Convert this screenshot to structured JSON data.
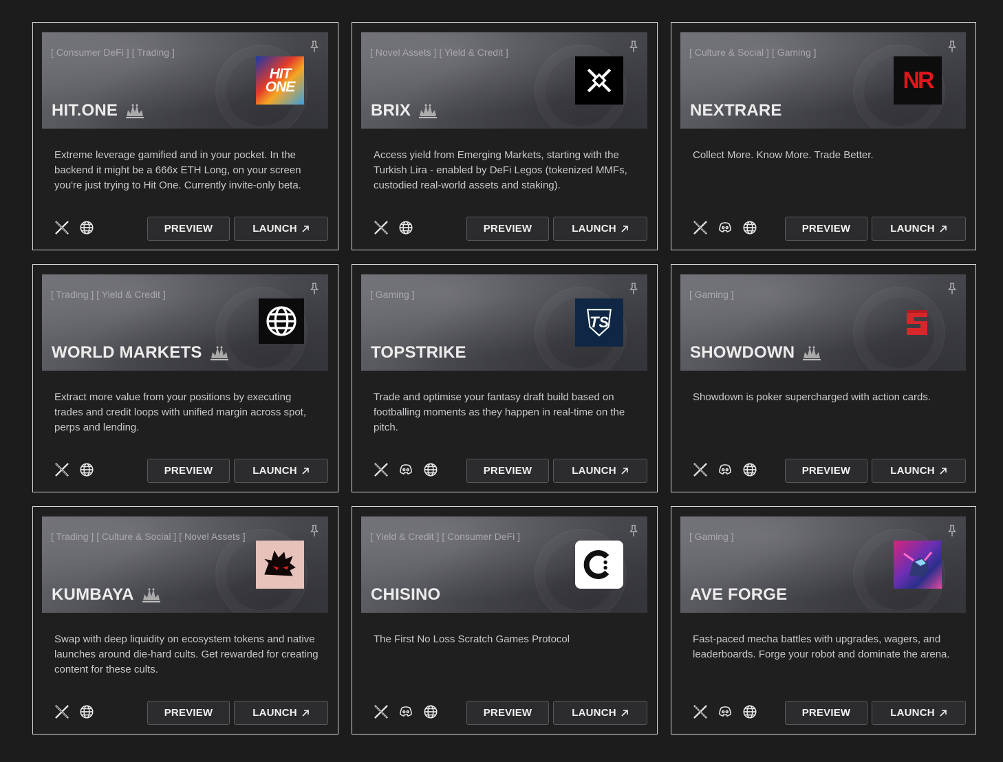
{
  "cards": [
    {
      "tags": [
        "[ Consumer DeFi ]",
        "[ Trading ]"
      ],
      "title": "HIT.ONE",
      "crown": true,
      "logo": "hitone",
      "description": "Extreme leverage gamified and in your pocket. In the backend it might be a 666x ETH Long, on your screen you're just trying to Hit One. Currently invite-only beta.",
      "socials": [
        "x",
        "globe"
      ],
      "preview": "PREVIEW",
      "launch": "LAUNCH"
    },
    {
      "tags": [
        "[ Novel Assets ]",
        "[ Yield & Credit ]"
      ],
      "title": "BRIX",
      "crown": true,
      "logo": "brix",
      "description": "Access yield from Emerging Markets, starting with the Turkish Lira - enabled by DeFi Legos (tokenized MMFs, custodied real-world assets and staking).",
      "socials": [
        "x",
        "globe"
      ],
      "preview": "PREVIEW",
      "launch": "LAUNCH"
    },
    {
      "tags": [
        "[ Culture & Social ]",
        "[ Gaming ]"
      ],
      "title": "NEXTRARE",
      "crown": false,
      "logo": "nextrare",
      "description": "Collect More. Know More. Trade Better.",
      "socials": [
        "x",
        "discord",
        "globe"
      ],
      "preview": "PREVIEW",
      "launch": "LAUNCH"
    },
    {
      "tags": [
        "[ Trading ]",
        "[ Yield & Credit ]"
      ],
      "title": "WORLD MARKETS",
      "crown": true,
      "logo": "world",
      "description": "Extract more value from your positions by executing trades and credit loops with unified margin across spot, perps and lending.",
      "socials": [
        "x",
        "globe"
      ],
      "preview": "PREVIEW",
      "launch": "LAUNCH"
    },
    {
      "tags": [
        "[ Gaming ]"
      ],
      "title": "TOPSTRIKE",
      "crown": false,
      "logo": "topstrike",
      "description": "Trade and optimise your fantasy draft build based on footballing moments as they happen in real-time on the pitch.",
      "socials": [
        "x",
        "discord",
        "globe"
      ],
      "preview": "PREVIEW",
      "launch": "LAUNCH"
    },
    {
      "tags": [
        "[ Gaming ]"
      ],
      "title": "SHOWDOWN",
      "crown": true,
      "logo": "showdown",
      "description": "Showdown is poker supercharged with action cards.",
      "socials": [
        "x",
        "discord",
        "globe"
      ],
      "preview": "PREVIEW",
      "launch": "LAUNCH"
    },
    {
      "tags": [
        "[ Trading ]",
        "[ Culture & Social ]",
        "[ Novel Assets ]"
      ],
      "title": "KUMBAYA",
      "crown": true,
      "logo": "kumbaya",
      "description": "Swap with deep liquidity on ecosystem tokens and native launches around die-hard cults. Get rewarded for creating content for these cults.",
      "socials": [
        "x",
        "globe"
      ],
      "preview": "PREVIEW",
      "launch": "LAUNCH"
    },
    {
      "tags": [
        "[ Yield & Credit ]",
        "[ Consumer DeFi ]"
      ],
      "title": "CHISINO",
      "crown": false,
      "logo": "chisino",
      "description": "The First No Loss Scratch Games Protocol",
      "socials": [
        "x",
        "discord",
        "globe"
      ],
      "preview": "PREVIEW",
      "launch": "LAUNCH"
    },
    {
      "tags": [
        "[ Gaming ]"
      ],
      "title": "AVE FORGE",
      "crown": false,
      "logo": "aveforge",
      "description": "Fast-paced mecha battles with upgrades, wagers, and leaderboards. Forge your robot and dominate the arena.",
      "socials": [
        "x",
        "discord",
        "globe"
      ],
      "preview": "PREVIEW",
      "launch": "LAUNCH"
    }
  ],
  "logo_text": {
    "hitone": "HIT ONE",
    "nextrare": "NR",
    "topstrike": "TS"
  },
  "colors": {
    "background": "#1c1c1d",
    "card_border": "#d6d6d6",
    "button_bg": "#2c2c2e"
  }
}
